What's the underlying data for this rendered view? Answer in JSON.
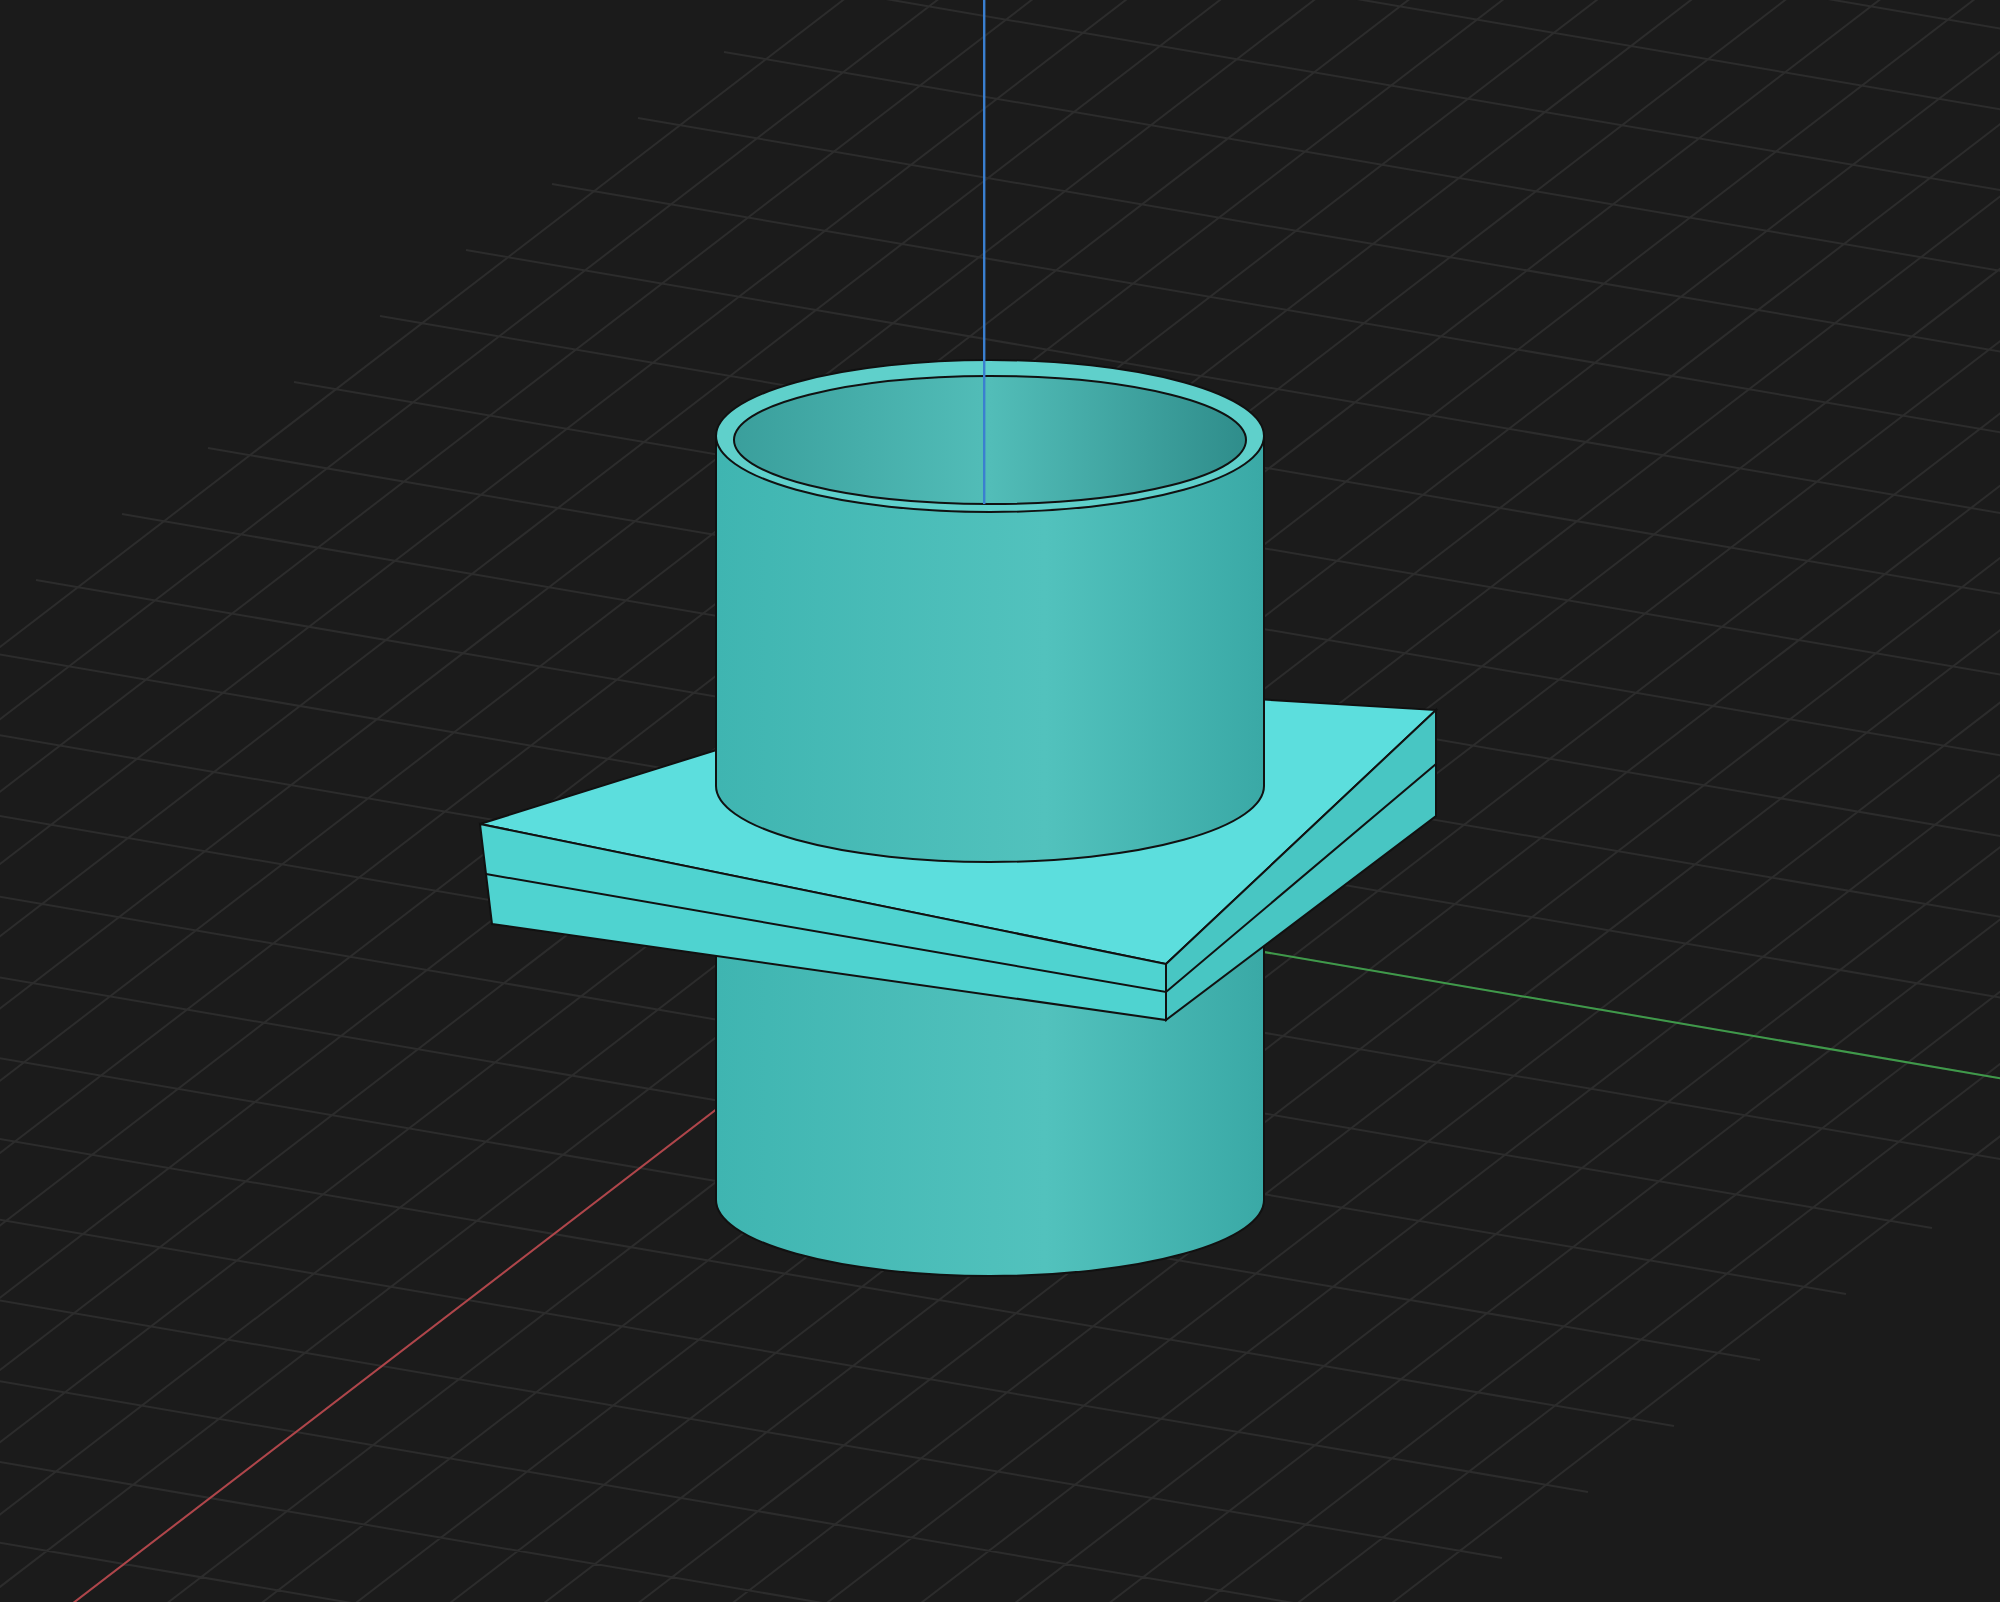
{
  "viewport": {
    "axes": [
      {
        "kind": "x",
        "color": "#b0454a"
      },
      {
        "kind": "y",
        "color": "#3f9a4a"
      },
      {
        "kind": "z",
        "color": "#3a7fd0"
      }
    ]
  }
}
